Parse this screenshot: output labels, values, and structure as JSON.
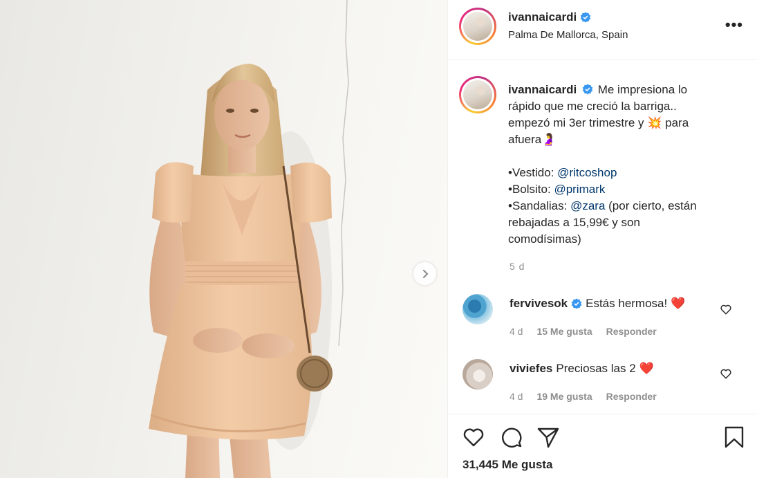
{
  "post": {
    "username": "ivannaicardi",
    "location": "Palma De Mallorca, Spain",
    "more_label": "•••"
  },
  "caption": {
    "username": "ivannaicardi",
    "line1": "Me impresiona lo",
    "line2": "rápido que me creció la barriga..",
    "line3a": "empezó mi 3er trimestre y ",
    "line3_emoji": "💥",
    "line3b": " para",
    "line4": "afuera",
    "line4_emoji": "🤰",
    "vestido_label": "•Vestido: ",
    "vestido_mention": "@ritcoshop",
    "bolsito_label": "•Bolsito: ",
    "bolsito_mention": "@primark",
    "sandalias_label": "•Sandalias: ",
    "sandalias_mention": "@zara",
    "sandalias_rest": " (por cierto, están",
    "line_rebajadas": "rebajadas a 15,99€ y son",
    "line_comod": "comodísimas)",
    "age": "5 d"
  },
  "comments": [
    {
      "username": "fervivesok",
      "verified": true,
      "text": "Estás hermosa!",
      "emoji": "❤️",
      "age": "4 d",
      "likes": "15 Me gusta",
      "reply": "Responder"
    },
    {
      "username": "viviefes",
      "verified": false,
      "text": "Preciosas las 2",
      "emoji": "❤️",
      "age": "4 d",
      "likes": "19 Me gusta",
      "reply": "Responder"
    }
  ],
  "footer": {
    "likes_count": "31,445 Me gusta"
  },
  "colors": {
    "verified_blue": "#3897f0",
    "heart_red": "#e0141e",
    "mention_blue": "#00376b",
    "dress": "#f1c7a0"
  },
  "icons": [
    "verified-badge-icon",
    "more-options-icon",
    "chevron-right-icon",
    "heart-icon",
    "comment-icon",
    "share-icon",
    "bookmark-icon"
  ]
}
